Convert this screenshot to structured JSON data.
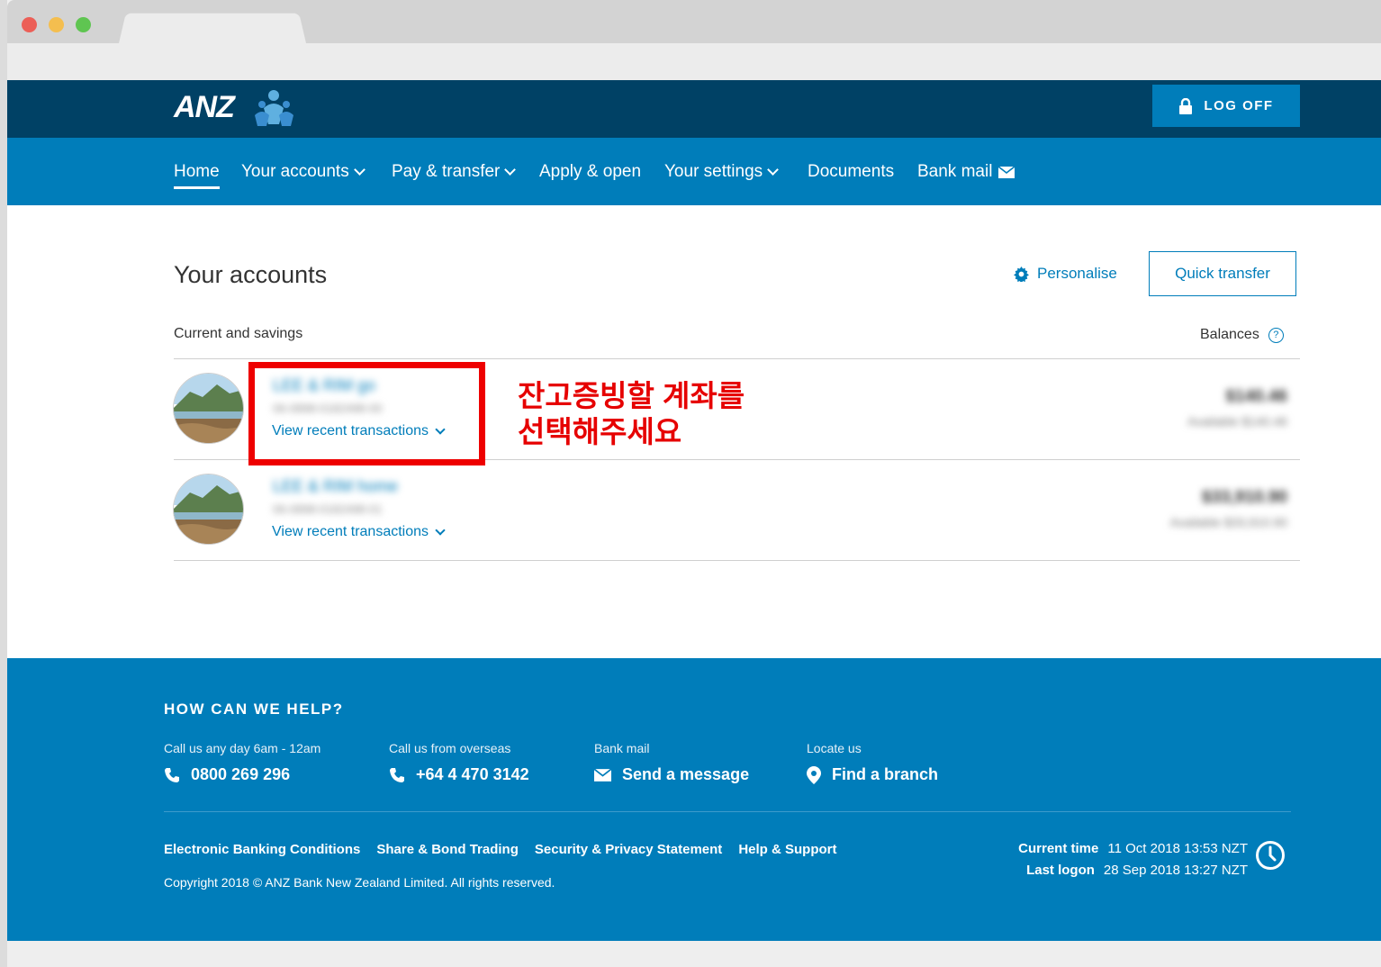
{
  "window": {
    "dots": [
      "#ec5f57",
      "#f4be4f",
      "#5fc551"
    ]
  },
  "header": {
    "logo_text": "ANZ",
    "logoff_label": "LOG OFF"
  },
  "nav": [
    {
      "label": "Home",
      "dropdown": false,
      "active": true
    },
    {
      "label": "Your accounts",
      "dropdown": true
    },
    {
      "label": "Pay & transfer",
      "dropdown": true
    },
    {
      "label": "Apply & open",
      "dropdown": false
    },
    {
      "label": "Your settings",
      "dropdown": true
    },
    {
      "label": "Documents",
      "dropdown": false
    },
    {
      "label": "Bank mail",
      "dropdown": false,
      "icon": "envelope-icon"
    }
  ],
  "main": {
    "title": "Your accounts",
    "personalise": "Personalise",
    "quick_transfer": "Quick transfer",
    "section": "Current and savings",
    "balances": "Balances",
    "accounts": [
      {
        "name": "LEE & RIM go",
        "number": "06-0898-0182498-00",
        "link": "View recent transactions",
        "balance": "$140.46",
        "available": "Available $140.46"
      },
      {
        "name": "LEE & RIM home",
        "number": "06-0898-0182498-01",
        "link": "View recent transactions",
        "balance": "$33,910.90",
        "available": "Available $33,910.90"
      }
    ],
    "callout": [
      "잔고증빙할 계좌를",
      "선택해주세요"
    ]
  },
  "footer": {
    "title": "HOW CAN WE HELP?",
    "contacts": [
      {
        "label": "Call us any day 6am - 12am",
        "value": "0800 269 296",
        "icon": "phone-icon"
      },
      {
        "label": "Call us from overseas",
        "value": "+64 4 470 3142",
        "icon": "phone-icon"
      },
      {
        "label": "Bank mail",
        "value": "Send a message",
        "icon": "envelope-icon"
      },
      {
        "label": "Locate us",
        "value": "Find a branch",
        "icon": "map-pin-icon"
      }
    ],
    "links": [
      "Electronic Banking Conditions",
      "Share & Bond Trading",
      "Security & Privacy Statement",
      "Help & Support"
    ],
    "copyright": "Copyright 2018 © ANZ Bank New Zealand Limited. All rights reserved.",
    "current_time_label": "Current time",
    "current_time": "11 Oct 2018 13:53 NZT",
    "last_logon_label": "Last logon",
    "last_logon": "28 Sep 2018 13:27 NZT"
  },
  "colors": {
    "navy": "#004165",
    "blue": "#007dba",
    "red": "#ee0000"
  }
}
